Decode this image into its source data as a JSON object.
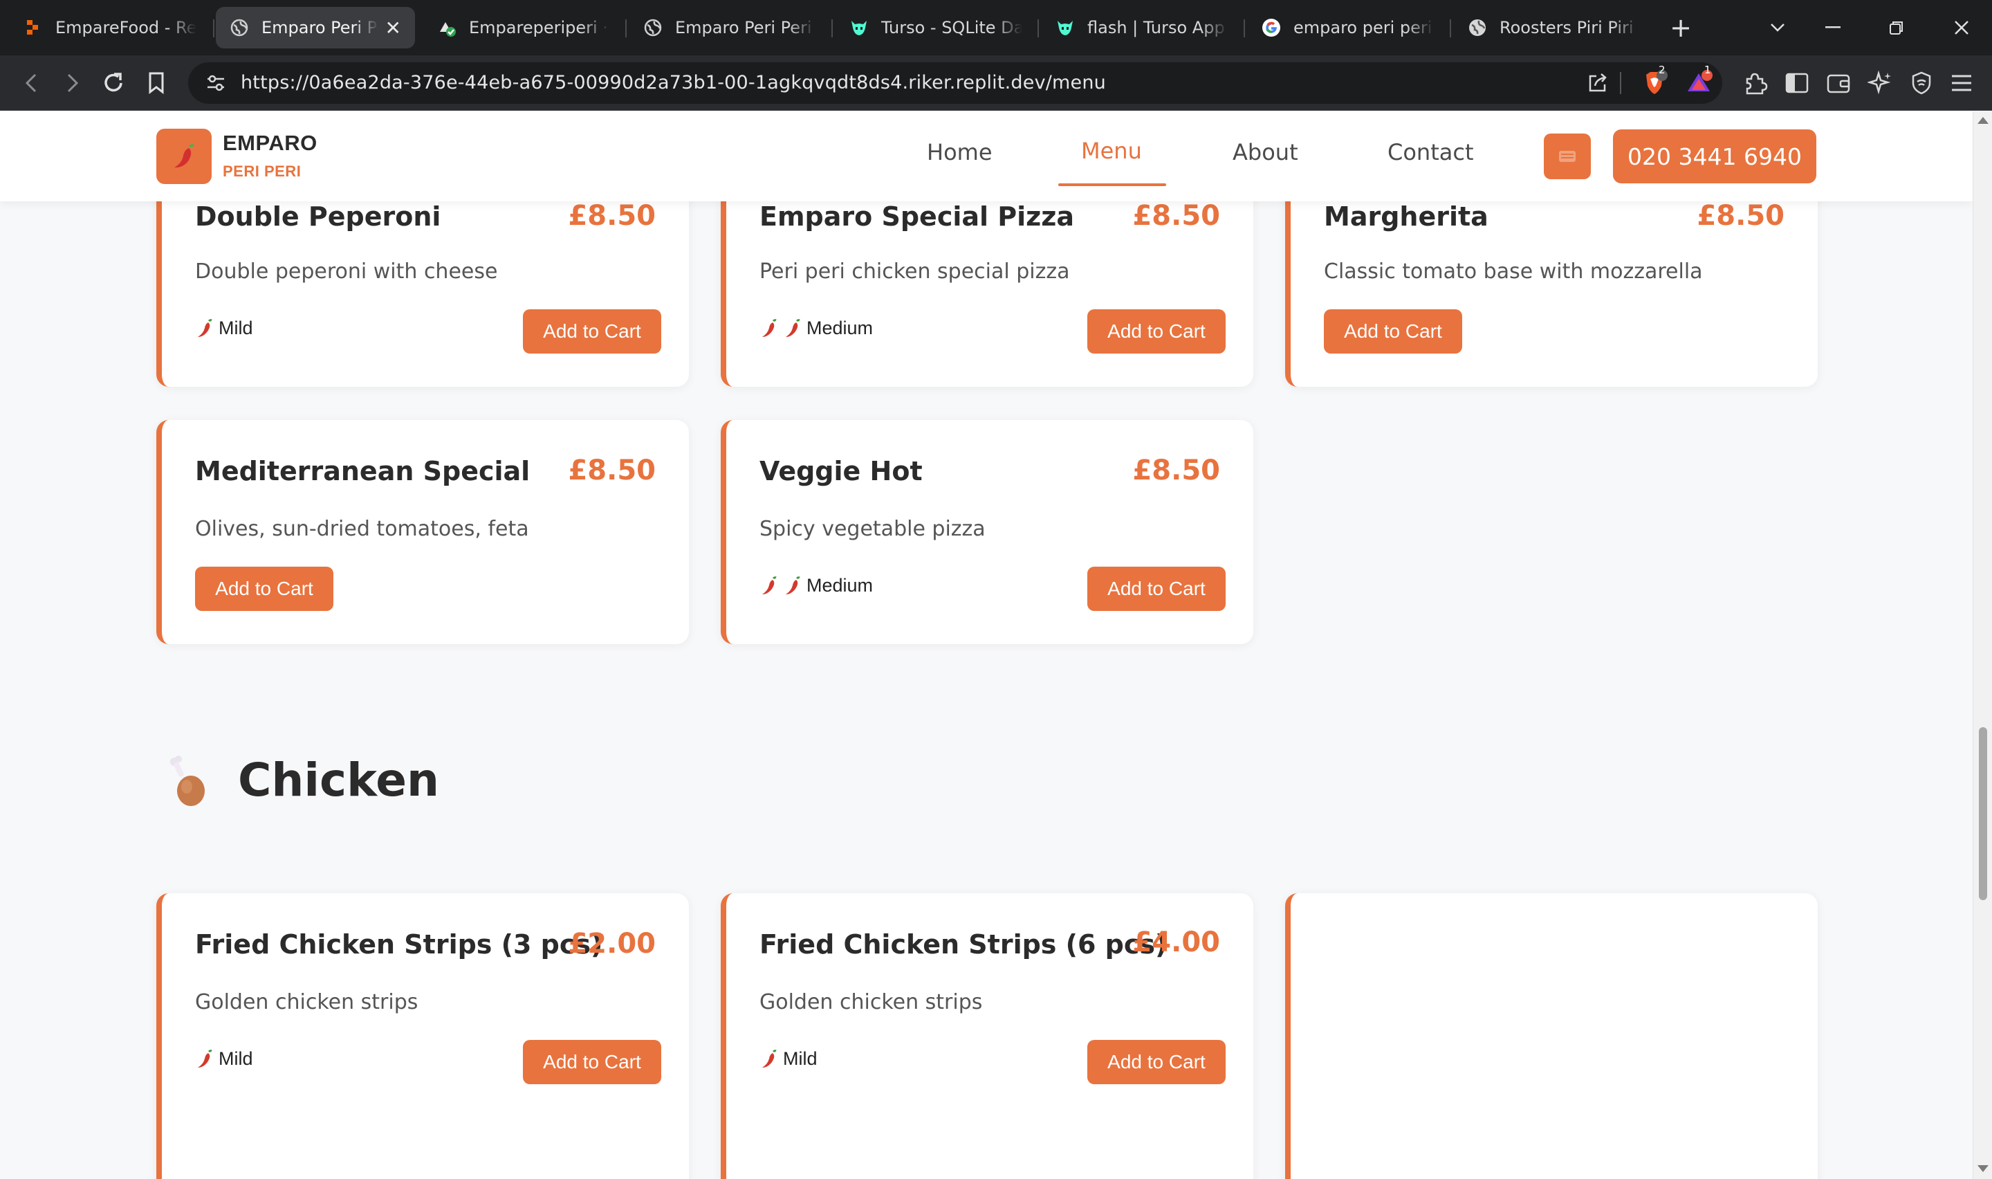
{
  "browser": {
    "tabs": [
      {
        "title": "EmpareFood - Rep",
        "active": false
      },
      {
        "title": "Emparo Peri Peri",
        "active": true
      },
      {
        "title": "Empareperiperi · V",
        "active": false
      },
      {
        "title": "Emparo Peri Peri -",
        "active": false
      },
      {
        "title": "Turso - SQLite Dat",
        "active": false
      },
      {
        "title": "flash | Turso App",
        "active": false
      },
      {
        "title": "emparo peri peri -",
        "active": false
      },
      {
        "title": "Roosters Piri Piri -",
        "active": false
      }
    ],
    "url": "https://0a6ea2da-376e-44eb-a675-00990d2a73b1-00-1agkqvqdt8ds4.riker.replit.dev/menu",
    "brave_badge": "2",
    "alert_badge": "1"
  },
  "site": {
    "brand_name": "EMPARO",
    "brand_sub": "PERI PERI",
    "nav": [
      {
        "label": "Home",
        "active": false
      },
      {
        "label": "Menu",
        "active": true
      },
      {
        "label": "About",
        "active": false
      },
      {
        "label": "Contact",
        "active": false
      }
    ],
    "phone": "020 3441 6940",
    "accent_color": "#e8733e"
  },
  "menu": {
    "pizza_items": [
      {
        "name": "Double Peperoni",
        "price": "£8.50",
        "description": "Double peperoni with cheese",
        "spice": "Mild",
        "chilies": 1,
        "button": "Add to Cart"
      },
      {
        "name": "Emparo Special Pizza",
        "price": "£8.50",
        "description": "Peri peri chicken special pizza",
        "spice": "Medium",
        "chilies": 2,
        "button": "Add to Cart"
      },
      {
        "name": "Margherita",
        "price": "£8.50",
        "description": "Classic tomato base with mozzarella",
        "spice": "",
        "chilies": 0,
        "button": "Add to Cart"
      },
      {
        "name": "Mediterranean Special",
        "price": "£8.50",
        "description": "Olives, sun-dried tomatoes, feta",
        "spice": "",
        "chilies": 0,
        "button": "Add to Cart"
      },
      {
        "name": "Veggie Hot",
        "price": "£8.50",
        "description": "Spicy vegetable pizza",
        "spice": "Medium",
        "chilies": 2,
        "button": "Add to Cart"
      }
    ],
    "chicken_section_title": "Chicken",
    "chicken_items": [
      {
        "name": "Fried Chicken Strips (3 pcs)",
        "price": "£2.00",
        "description": "Golden chicken strips",
        "spice": "Mild",
        "chilies": 1,
        "button": "Add to Cart"
      },
      {
        "name": "Fried Chicken Strips (6 pcs)",
        "price": "£4.00",
        "description": "Golden chicken strips",
        "spice": "Mild",
        "chilies": 1,
        "button": "Add to Cart"
      }
    ]
  }
}
